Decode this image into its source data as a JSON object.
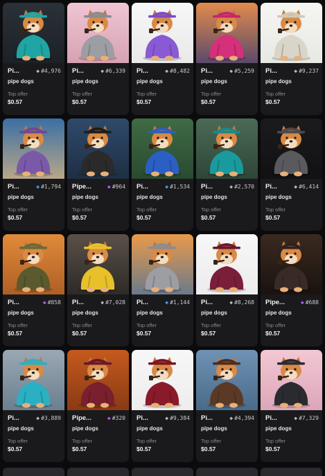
{
  "collection": "pipe dogs",
  "offer_label": "Top offer",
  "rank_colors": {
    "gray": "#b8b8bd",
    "blue": "#3b9cff",
    "purple": "#b15cff"
  },
  "cards": [
    {
      "name": "Pi...",
      "rank": "#4,976",
      "tier": "gray",
      "outfit": "#1fa5a3",
      "hat": "#1fa5a3",
      "bg": "#2b3138",
      "bg2": "#1c2126"
    },
    {
      "name": "Pi...",
      "rank": "#6,339",
      "tier": "gray",
      "outfit": "#9c9ea3",
      "hat": "#8a8c92",
      "bg": "#f0c5d3",
      "bg2": "#d7a2b3"
    },
    {
      "name": "Pi...",
      "rank": "#8,482",
      "tier": "gray",
      "outfit": "#8a5ad6",
      "hat": "#7b4cc7",
      "bg": "#f7f7f7",
      "bg2": "#e9e9e9"
    },
    {
      "name": "Pi...",
      "rank": "#5,259",
      "tier": "gray",
      "outfit": "#d62f7c",
      "hat": "#c7246d",
      "bg": "#e28b4d",
      "bg2": "#5b4a6a"
    },
    {
      "name": "Pi...",
      "rank": "#9,237",
      "tier": "gray",
      "outfit": "#d9d5c8",
      "hat": "#cfcabb",
      "bg": "#f5f5f2",
      "bg2": "#e8e8e4"
    },
    {
      "name": "Pi...",
      "rank": "#1,794",
      "tier": "blue",
      "outfit": "#7a5aa8",
      "hat": "#6a4a98",
      "bg": "#3a6fa3",
      "bg2": "#b9a78a"
    },
    {
      "name": "Pipe...",
      "rank": "#964",
      "tier": "purple",
      "outfit": "#2a2a2a",
      "hat": "#1e1e1e",
      "bg": "#2f4a6a",
      "bg2": "#1e2f44"
    },
    {
      "name": "Pi...",
      "rank": "#1,534",
      "tier": "blue",
      "outfit": "#2b5fc4",
      "hat": "#2b5fc4",
      "bg": "#3f6b45",
      "bg2": "#2a4a30"
    },
    {
      "name": "Pi...",
      "rank": "#2,570",
      "tier": "gray",
      "outfit": "#1a9a9c",
      "hat": "#168a8c",
      "bg": "#4b6a55",
      "bg2": "#2e4638"
    },
    {
      "name": "Pi...",
      "rank": "#6,414",
      "tier": "gray",
      "outfit": "#5a5a5e",
      "hat": "#4a4a4e",
      "bg": "#1b1b1d",
      "bg2": "#111113"
    },
    {
      "name": "Pi...",
      "rank": "#858",
      "tier": "purple",
      "outfit": "#5a5a2e",
      "hat": "#6b6a3a",
      "bg": "#e08a3a",
      "bg2": "#b05f25"
    },
    {
      "name": "Pi...",
      "rank": "#7,028",
      "tier": "gray",
      "outfit": "#e8c12a",
      "hat": "#e8c12a",
      "bg": "#5a5048",
      "bg2": "#2e2a26"
    },
    {
      "name": "Pi...",
      "rank": "#1,144",
      "tier": "blue",
      "outfit": "#9c9ea3",
      "hat": "#8a8c92",
      "bg": "#e89a4a",
      "bg2": "#6b7a8a"
    },
    {
      "name": "Pi...",
      "rank": "#8,268",
      "tier": "gray",
      "outfit": "#7a1f3a",
      "hat": "#6a1830",
      "bg": "#f7f7f7",
      "bg2": "#ececec"
    },
    {
      "name": "Pipe...",
      "rank": "#688",
      "tier": "purple",
      "outfit": "#3a2a26",
      "hat": "#2e2220",
      "bg": "#3a2a20",
      "bg2": "#1a1210"
    },
    {
      "name": "Pi...",
      "rank": "#3,889",
      "tier": "gray",
      "outfit": "#2ab0c2",
      "hat": "#2ab0c2",
      "bg": "#9aa8b3",
      "bg2": "#6b7f8f"
    },
    {
      "name": "Pipe...",
      "rank": "#320",
      "tier": "purple",
      "outfit": "#7a1f2e",
      "hat": "#6a1828",
      "bg": "#c55a1e",
      "bg2": "#8a3a14"
    },
    {
      "name": "Pi...",
      "rank": "#9,384",
      "tier": "gray",
      "outfit": "#8a1a2a",
      "hat": "#7a1424",
      "bg": "#f7f7f7",
      "bg2": "#ededed"
    },
    {
      "name": "Pi...",
      "rank": "#4,394",
      "tier": "gray",
      "outfit": "#5a3a26",
      "hat": "#4a2e1e",
      "bg": "#6f93b5",
      "bg2": "#4a6a88"
    },
    {
      "name": "Pi...",
      "rank": "#7,329",
      "tier": "gray",
      "outfit": "#2a2a30",
      "hat": "#2a2a30",
      "bg": "#f3c7d4",
      "bg2": "#dca6b8"
    }
  ],
  "price": "$0.57"
}
